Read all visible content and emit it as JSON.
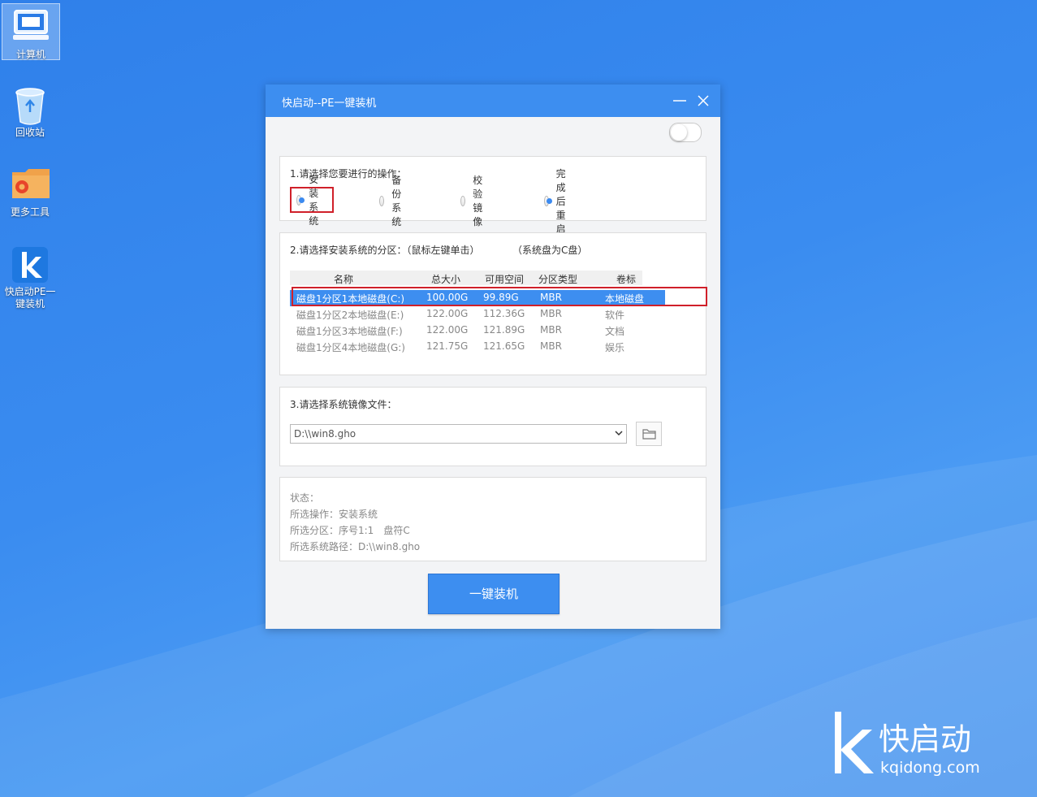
{
  "desktop": {
    "icons": [
      {
        "label": "计算机",
        "icon": "computer-icon",
        "selected": true
      },
      {
        "label": "回收站",
        "icon": "recycle-bin-icon"
      },
      {
        "label": "更多工具",
        "icon": "tools-folder-icon"
      },
      {
        "label": "快启动PE一键装机",
        "icon": "kuaiqidong-app-icon"
      }
    ]
  },
  "window": {
    "title": "快启动--PE一键装机",
    "minimize_icon": "minimize-icon",
    "close_icon": "close-icon",
    "toggle_on": false,
    "section1": {
      "title": "1.请选择您要进行的操作：",
      "options": [
        {
          "label": "安装系统",
          "checked": true
        },
        {
          "label": "备份系统",
          "checked": false
        },
        {
          "label": "校验镜像",
          "checked": false
        },
        {
          "label": "完成后重启",
          "checked": true
        }
      ]
    },
    "section2": {
      "title": "2.请选择安装系统的分区：（鼠标左键单击）",
      "hint": "（系统盘为C盘）",
      "columns": [
        "名称",
        "总大小",
        "可用空间",
        "分区类型",
        "卷标"
      ],
      "rows": [
        {
          "name": "磁盘1分区1本地磁盘(C:)",
          "total": "100.00G",
          "free": "99.89G",
          "type": "MBR",
          "label": "本地磁盘",
          "selected": true
        },
        {
          "name": "磁盘1分区2本地磁盘(E:)",
          "total": "122.00G",
          "free": "112.36G",
          "type": "MBR",
          "label": "软件"
        },
        {
          "name": "磁盘1分区3本地磁盘(F:)",
          "total": "122.00G",
          "free": "121.89G",
          "type": "MBR",
          "label": "文档"
        },
        {
          "name": "磁盘1分区4本地磁盘(G:)",
          "total": "121.75G",
          "free": "121.65G",
          "type": "MBR",
          "label": "娱乐"
        }
      ]
    },
    "section3": {
      "title": "3.请选择系统镜像文件：",
      "image_path": "D:\\\\win8.gho",
      "browse_icon": "folder-icon"
    },
    "status": {
      "title": "状态：",
      "lines": [
        "所选操作：安装系统",
        "所选分区：序号1:1　盘符C",
        "所选系统路径：D:\\\\win8.gho"
      ]
    },
    "install_button": "一键装机"
  },
  "brand": {
    "name": "快启动",
    "url": "kqidong.com"
  }
}
